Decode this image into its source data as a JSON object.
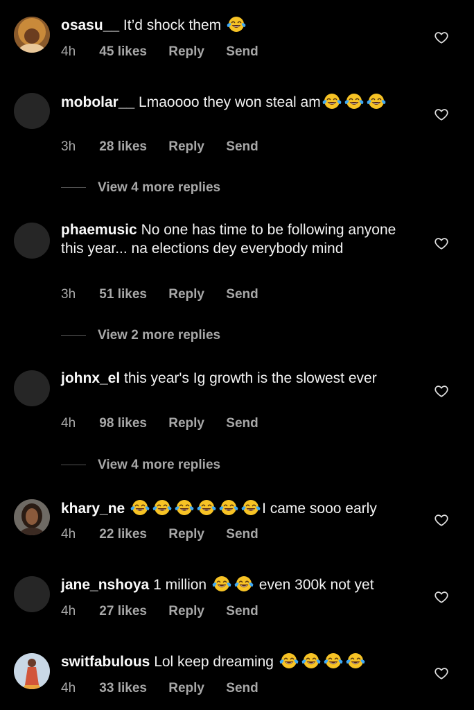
{
  "comments": [
    {
      "username": "osasu__",
      "text_before": "It’d shock them ",
      "emoji_count": 1,
      "text_after": "",
      "time": "4h",
      "likes": "45 likes",
      "reply": "Reply",
      "send": "Send",
      "avatar": "photo"
    },
    {
      "username": "mobolar__",
      "text_before": "Lmaoooo they won steal am",
      "emoji_count": 3,
      "text_after": "",
      "time": "3h",
      "likes": "28 likes",
      "reply": "Reply",
      "send": "Send",
      "more_replies": "View 4 more replies",
      "avatar": "blank"
    },
    {
      "username": "phaemusic",
      "text_before": "No one has time to be following anyone this year... na elections dey everybody mind",
      "emoji_count": 0,
      "text_after": "",
      "time": "3h",
      "likes": "51 likes",
      "reply": "Reply",
      "send": "Send",
      "more_replies": "View 2 more replies",
      "avatar": "blank"
    },
    {
      "username": "johnx_el",
      "text_before": "this year's  Ig growth is the slowest ever",
      "emoji_count": 0,
      "text_after": "",
      "time": "4h",
      "likes": "98 likes",
      "reply": "Reply",
      "send": "Send",
      "more_replies": "View 4 more replies",
      "avatar": "blank"
    },
    {
      "username": "khary_ne",
      "text_before": "",
      "emoji_count": 6,
      "text_after": "I came sooo early",
      "time": "4h",
      "likes": "22 likes",
      "reply": "Reply",
      "send": "Send",
      "avatar": "photo"
    },
    {
      "username": "jane_nshoya",
      "text_before": "1 million ",
      "emoji_count": 2,
      "text_after": " even 300k not yet",
      "time": "4h",
      "likes": "27 likes",
      "reply": "Reply",
      "send": "Send",
      "avatar": "blank"
    },
    {
      "username": "switfabulous",
      "text_before": "Lol keep dreaming ",
      "emoji_count": 4,
      "text_after": "",
      "time": "4h",
      "likes": "33 likes",
      "reply": "Reply",
      "send": "Send",
      "avatar": "photo"
    }
  ],
  "icons": {
    "like": "heart-outline-icon",
    "emoji": "face-with-tears-of-joy-emoji"
  },
  "colors": {
    "background": "#000000",
    "text": "#f5f5f5",
    "meta": "#a8a8a8",
    "avatar_placeholder": "#262626",
    "emoji_face": "#f7c325",
    "emoji_tears": "#3fa9f5"
  }
}
